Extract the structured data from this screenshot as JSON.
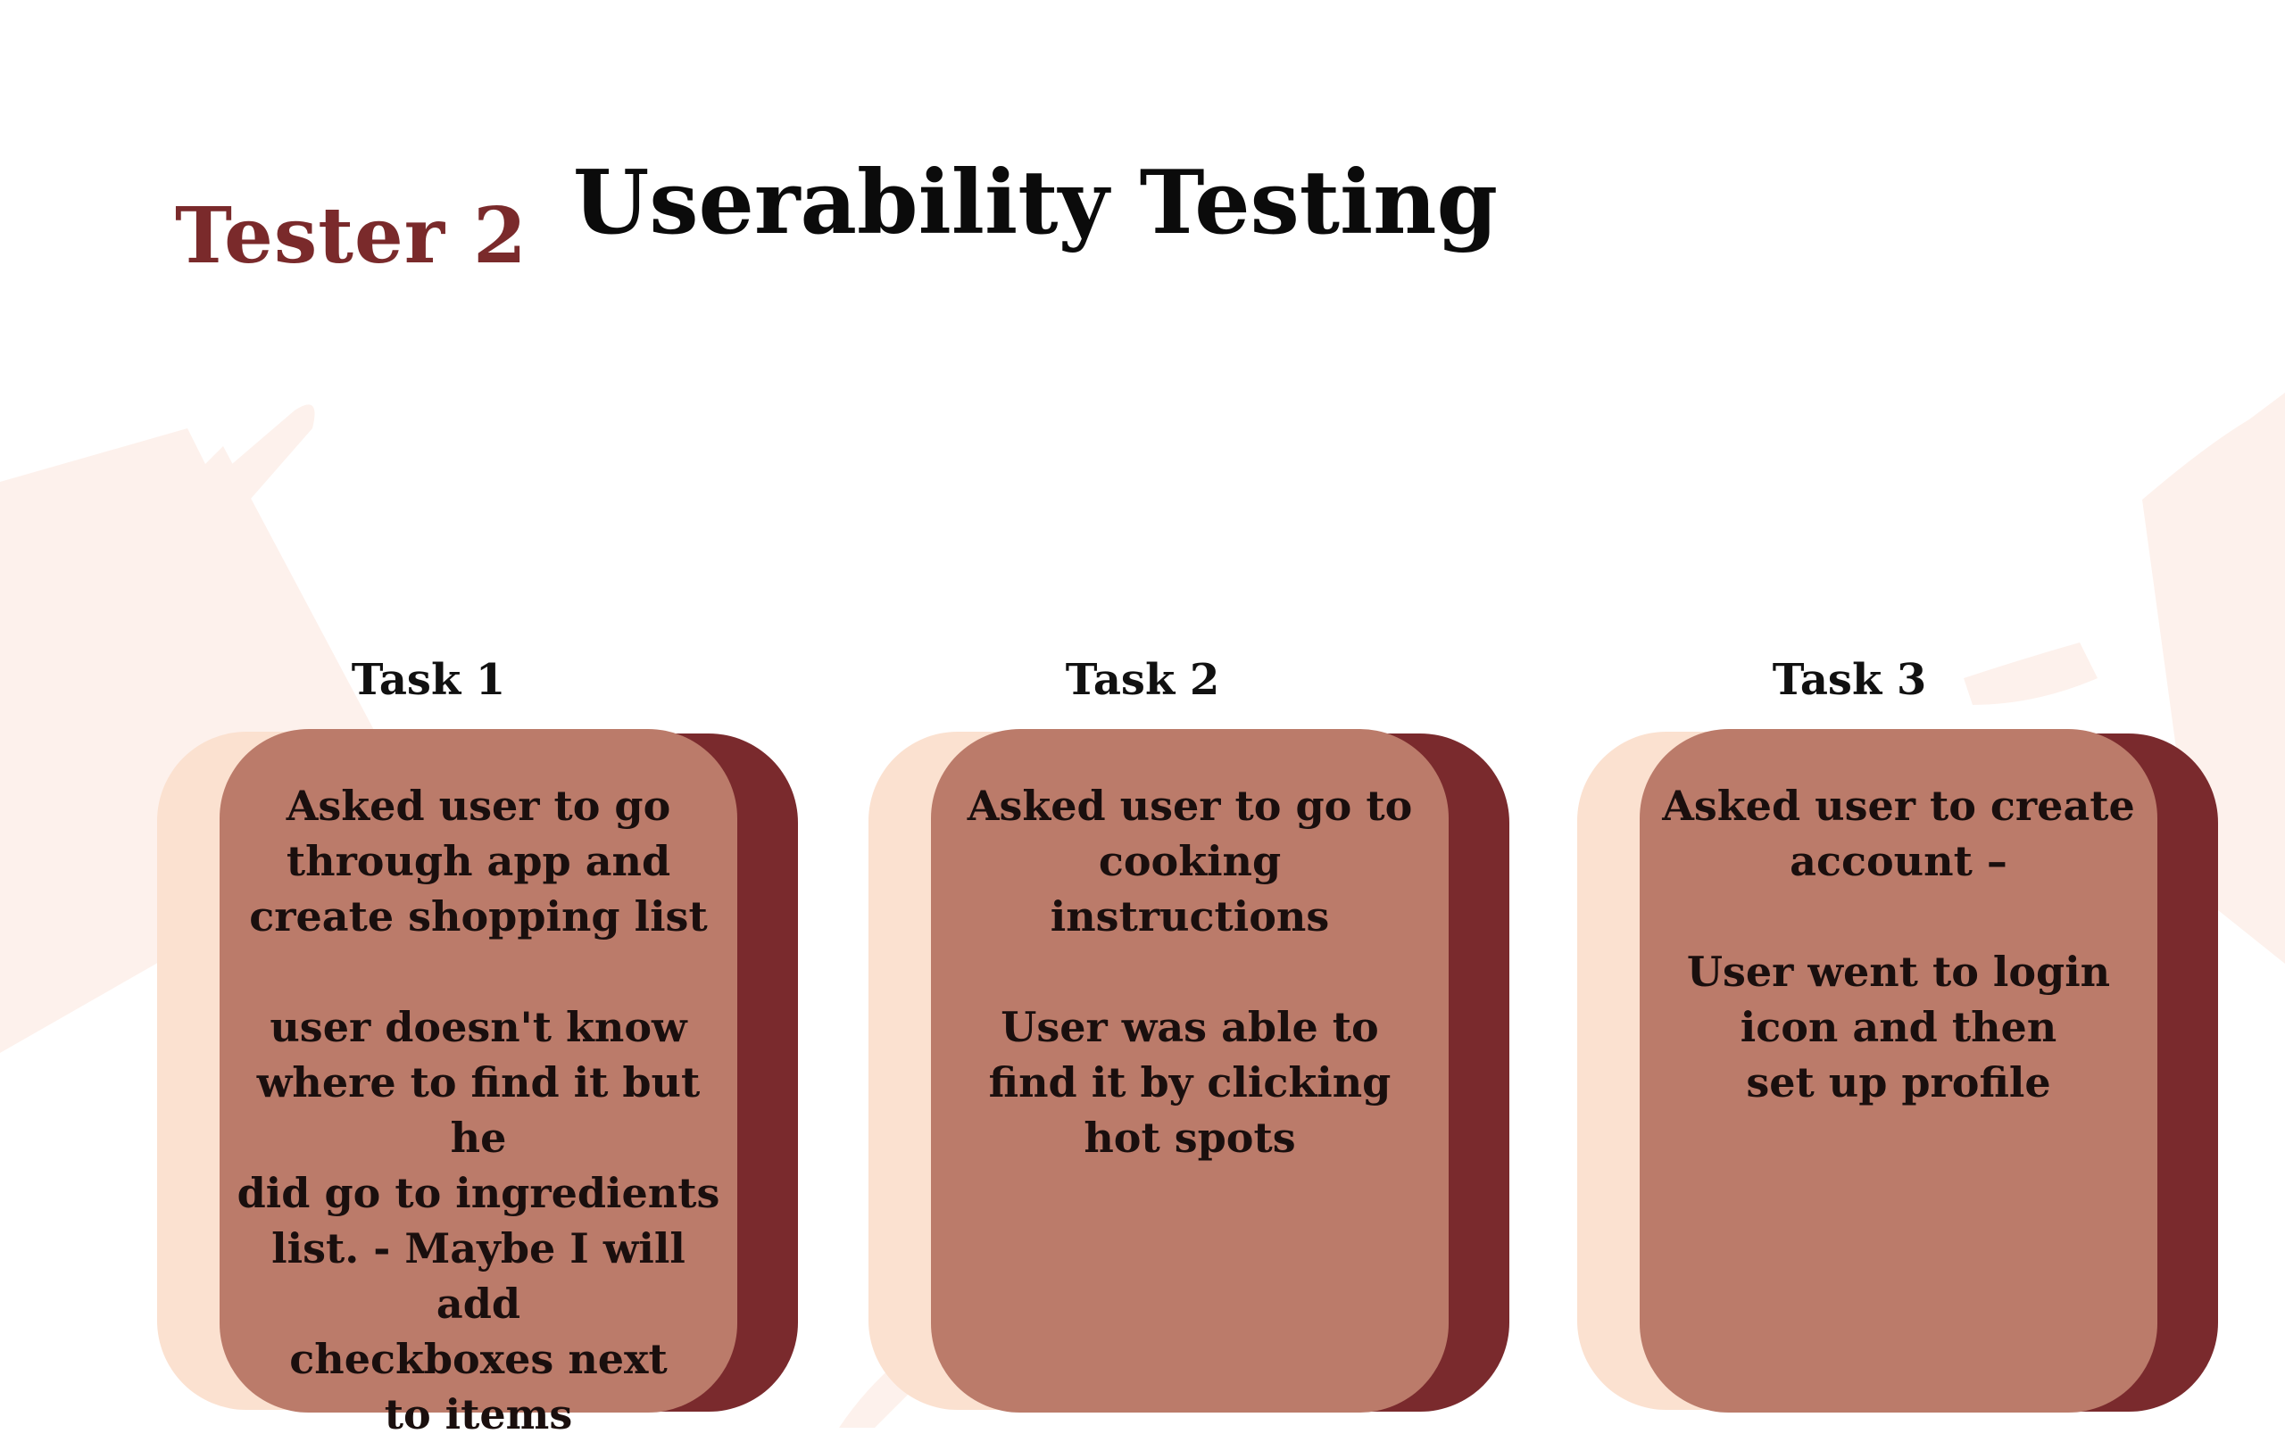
{
  "header": {
    "tester": "Tester 2",
    "title": "Userability Testing"
  },
  "tasks": [
    {
      "label": "Task 1",
      "text": "Asked user to go\nthrough app and\ncreate shopping list\n\nuser doesn't know\nwhere to find it but he\ndid go to ingredients\nlist. - Maybe I will add\ncheckboxes next\nto items"
    },
    {
      "label": "Task 2",
      "text": "Asked user to go to\ncooking\ninstructions\n\nUser was able to\nfind it by clicking\nhot spots"
    },
    {
      "label": "Task 3",
      "text": "Asked user to create\naccount –\n\nUser went to login\nicon and then\nset up profile"
    }
  ],
  "colors": {
    "accent": "#7a2a2b",
    "card": "#bb7b6a",
    "card_shadow_light": "#fbe1d0",
    "card_shadow_dark": "#7a2a2d"
  }
}
